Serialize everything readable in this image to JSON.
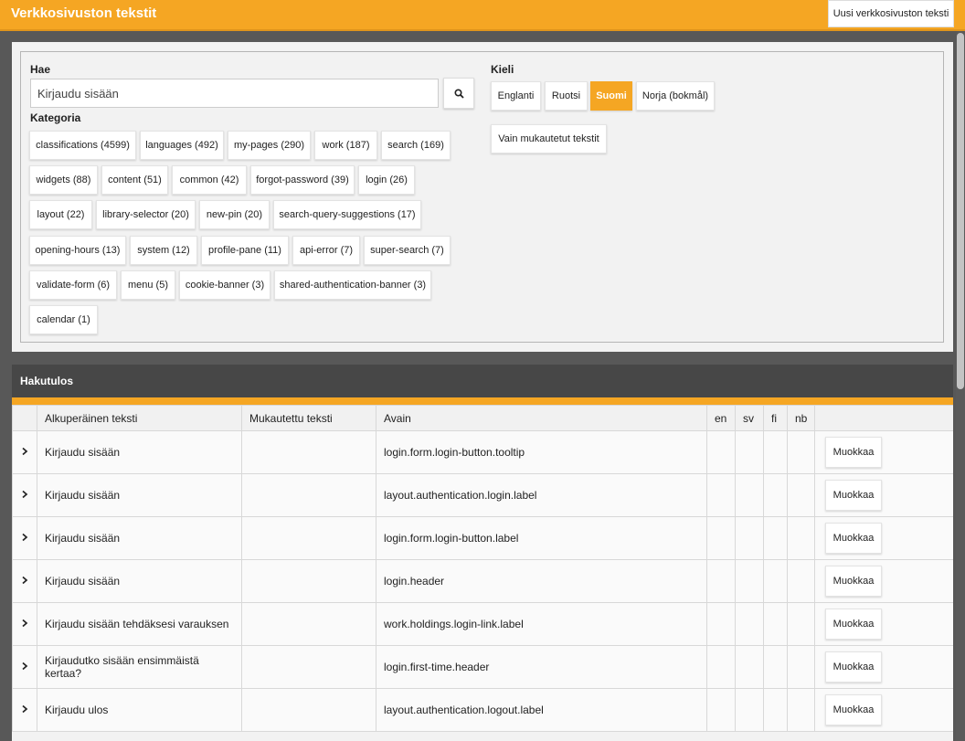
{
  "header": {
    "title": "Verkkosivuston tekstit",
    "new_button": "Uusi verkkosivuston teksti"
  },
  "search": {
    "label": "Hae",
    "value": "Kirjaudu sisään",
    "button_icon": "search-icon"
  },
  "category": {
    "label": "Kategoria",
    "chips": [
      "classifications (4599)",
      "languages (492)",
      "my-pages (290)",
      "work (187)",
      "search (169)",
      "widgets (88)",
      "content (51)",
      "common (42)",
      "forgot-password (39)",
      "login (26)",
      "layout (22)",
      "library-selector (20)",
      "new-pin (20)",
      "search-query-suggestions (17)",
      "opening-hours (13)",
      "system (12)",
      "profile-pane (11)",
      "api-error (7)",
      "super-search (7)",
      "validate-form (6)",
      "menu (5)",
      "cookie-banner (3)",
      "shared-authentication-banner (3)",
      "calendar (1)"
    ]
  },
  "language": {
    "label": "Kieli",
    "options": [
      "Englanti",
      "Ruotsi",
      "Suomi",
      "Norja (bokmål)"
    ],
    "selected": "Suomi",
    "only_custom": "Vain mukautetut tekstit"
  },
  "results": {
    "title": "Hakutulos",
    "columns": [
      "Alkuperäinen teksti",
      "Mukautettu teksti",
      "Avain",
      "en",
      "sv",
      "fi",
      "nb"
    ],
    "edit_label": "Muokkaa",
    "rows": [
      {
        "original": "Kirjaudu sisään",
        "custom": "",
        "key": "login.form.login-button.tooltip"
      },
      {
        "original": "Kirjaudu sisään",
        "custom": "",
        "key": "layout.authentication.login.label"
      },
      {
        "original": "Kirjaudu sisään",
        "custom": "",
        "key": "login.form.login-button.label"
      },
      {
        "original": "Kirjaudu sisään",
        "custom": "",
        "key": "login.header"
      },
      {
        "original": "Kirjaudu sisään tehdäksesi varauksen",
        "custom": "",
        "key": "work.holdings.login-link.label"
      },
      {
        "original": "Kirjaudutko sisään ensimmäistä kertaa?",
        "custom": "",
        "key": "login.first-time.header"
      },
      {
        "original": "Kirjaudu ulos",
        "custom": "",
        "key": "layout.authentication.logout.label"
      }
    ]
  },
  "colors": {
    "accent": "#f5a623",
    "header_dark": "#474747",
    "background": "#585858"
  }
}
